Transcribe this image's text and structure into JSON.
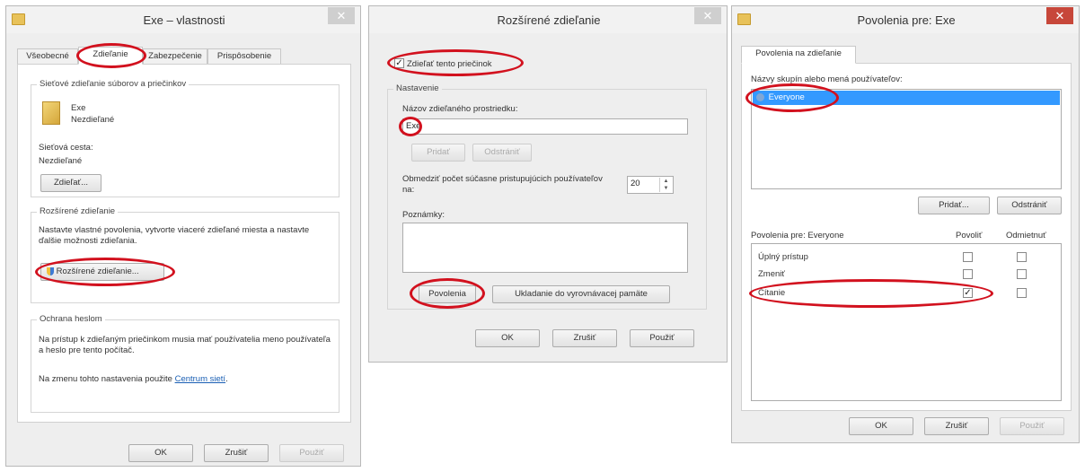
{
  "w1": {
    "title": "Exe – vlastnosti",
    "close": "✕",
    "tabs": [
      "Všeobecné",
      "Zdieľanie",
      "Zabezpečenie",
      "Prispôsobenie"
    ],
    "network_group": {
      "title": "Sieťové zdieľanie súborov a priečinkov",
      "folder_name": "Exe",
      "folder_state": "Nezdieľané",
      "path_label": "Sieťová cesta:",
      "path_value": "Nezdieľané",
      "share_button": "Zdieľať..."
    },
    "advanced_group": {
      "title": "Rozšírené zdieľanie",
      "description": "Nastavte vlastné povolenia, vytvorte viaceré zdieľané miesta a nastavte ďalšie možnosti zdieľania.",
      "button": "Rozšírené zdieľanie..."
    },
    "password_group": {
      "title": "Ochrana heslom",
      "description": "Na prístup k zdieľaným priečinkom musia mať používatelia meno používateľa a heslo pre tento počítač.",
      "change_prefix": "Na zmenu tohto nastavenia použite",
      "change_link": "Centrum sietí"
    },
    "buttons": {
      "ok": "OK",
      "cancel": "Zrušiť",
      "apply": "Použiť"
    }
  },
  "w2": {
    "title": "Rozšírené zdieľanie",
    "close": "✕",
    "share_checkbox": "Zdieľať tento priečinok",
    "share_checked": true,
    "settings_title": "Nastavenie",
    "share_name_label": "Názov zdieľaného prostriedku:",
    "share_name_value": "Exe",
    "add": "Pridať",
    "remove": "Odstrániť",
    "limit_label": "Obmedziť počet súčasne pristupujúcich používateľov na:",
    "limit_value": "20",
    "notes_label": "Poznámky:",
    "permissions_button": "Povolenia",
    "caching_button": "Ukladanie do vyrovnávacej pamäte",
    "buttons": {
      "ok": "OK",
      "cancel": "Zrušiť",
      "apply": "Použiť"
    }
  },
  "w3": {
    "title": "Povolenia pre: Exe",
    "close": "✕",
    "tab": "Povolenia na zdieľanie",
    "users_label": "Názvy skupín alebo mená používateľov:",
    "users": [
      "Everyone"
    ],
    "add": "Pridať...",
    "remove": "Odstrániť",
    "perm_header": "Povolenia pre: Everyone",
    "allow_header": "Povoliť",
    "deny_header": "Odmietnuť",
    "permissions": [
      {
        "name": "Úplný prístup",
        "allow": false,
        "deny": false
      },
      {
        "name": "Zmeniť",
        "allow": false,
        "deny": false
      },
      {
        "name": "Čítanie",
        "allow": true,
        "deny": false
      }
    ],
    "buttons": {
      "ok": "OK",
      "cancel": "Zrušiť",
      "apply": "Použiť"
    }
  },
  "colors": {
    "highlight_oval": "#d2111e",
    "selection": "#3399ff",
    "close_red": "#c7473a"
  }
}
